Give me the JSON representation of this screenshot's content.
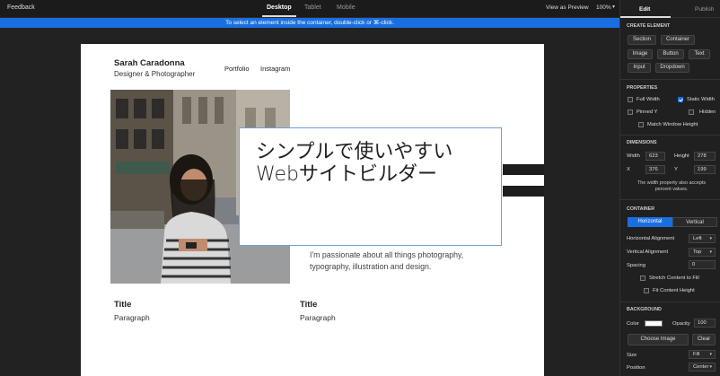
{
  "topbar": {
    "feedback": "Feedback",
    "tabs": [
      "Desktop",
      "Tablet",
      "Mobile"
    ],
    "view_preview": "View as Preview",
    "zoom": "100%"
  },
  "notice": "To select an element inside the container, double-click or ⌘-click.",
  "site": {
    "name": "Sarah Caradonna",
    "tagline": "Designer & Photographer",
    "nav": [
      "Portfolio",
      "Instagram"
    ],
    "hero_text": "シンプルで使いやすい\nWebサイトビルダー",
    "about": "I'm passionate about all things photography, typography, illustration and design.",
    "columns": [
      {
        "title": "Title",
        "paragraph": "Paragraph"
      },
      {
        "title": "Title",
        "paragraph": "Paragraph"
      }
    ]
  },
  "panel": {
    "tabs": [
      "Edit",
      "Publish"
    ],
    "create_element": {
      "heading": "CREATE ELEMENT",
      "buttons": [
        "Section",
        "Container",
        "Image",
        "Button",
        "Text",
        "Input",
        "Dropdown"
      ]
    },
    "properties": {
      "heading": "PROPERTIES",
      "full_width": "Full Width",
      "static_width": "Static Width",
      "pinned_y": "Pinned Y",
      "hidden": "Hidden",
      "match_window_height": "Match Window Height"
    },
    "dimensions": {
      "heading": "DIMENSIONS",
      "width_label": "Width",
      "width_value": "623",
      "height_label": "Height",
      "height_value": "278",
      "x_label": "X",
      "x_value": "376",
      "y_label": "Y",
      "y_value": "199",
      "note": "The width property also accepts percent values."
    },
    "container": {
      "heading": "CONTAINER",
      "seg_horizontal": "Horizontal",
      "seg_vertical": "Vertical",
      "h_align_label": "Horizontal Alignment",
      "h_align_value": "Left",
      "v_align_label": "Vertical Alignment",
      "v_align_value": "Top",
      "spacing_label": "Spacing",
      "spacing_value": "0",
      "stretch": "Stretch Content to Fill",
      "fit": "Fit Content Height"
    },
    "background": {
      "heading": "BACKGROUND",
      "color_label": "Color",
      "color_value": "#ffffff",
      "opacity_label": "Opacity",
      "opacity_value": "100",
      "choose_image": "Choose Image",
      "clear": "Clear",
      "size_label": "Size",
      "size_value": "Fill",
      "position_label": "Position",
      "position_value": "Center"
    }
  }
}
